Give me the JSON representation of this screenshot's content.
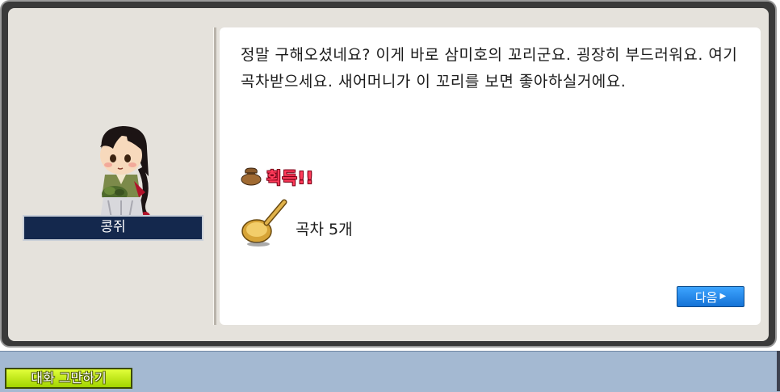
{
  "npc": {
    "name": "콩쥐",
    "portrait_icon": "kongjwi-npc-portrait"
  },
  "dialog": {
    "message": "정말 구해오셨네요? 이게 바로 삼미호의 꼬리군요. 굉장히 부드러워요. 여기 곡차받으세요. 새어머니가 이 꼬리를 보면 좋아하실거에요.",
    "acquire_label": "획득!!",
    "acquire_icon": "item-bag-icon",
    "reward": {
      "icon": "gold-ladle-icon",
      "label": "곡차 5개"
    },
    "next_button_label": "다음"
  },
  "footer": {
    "quit_button_label": "대화 그만하기"
  },
  "colors": {
    "name_plate_bg": "#14284d",
    "acquire_text": "#ff3b5a",
    "next_button": "#1f8af0",
    "quit_button": "#c7ef10",
    "bottom_bar": "#a4b9d2"
  }
}
